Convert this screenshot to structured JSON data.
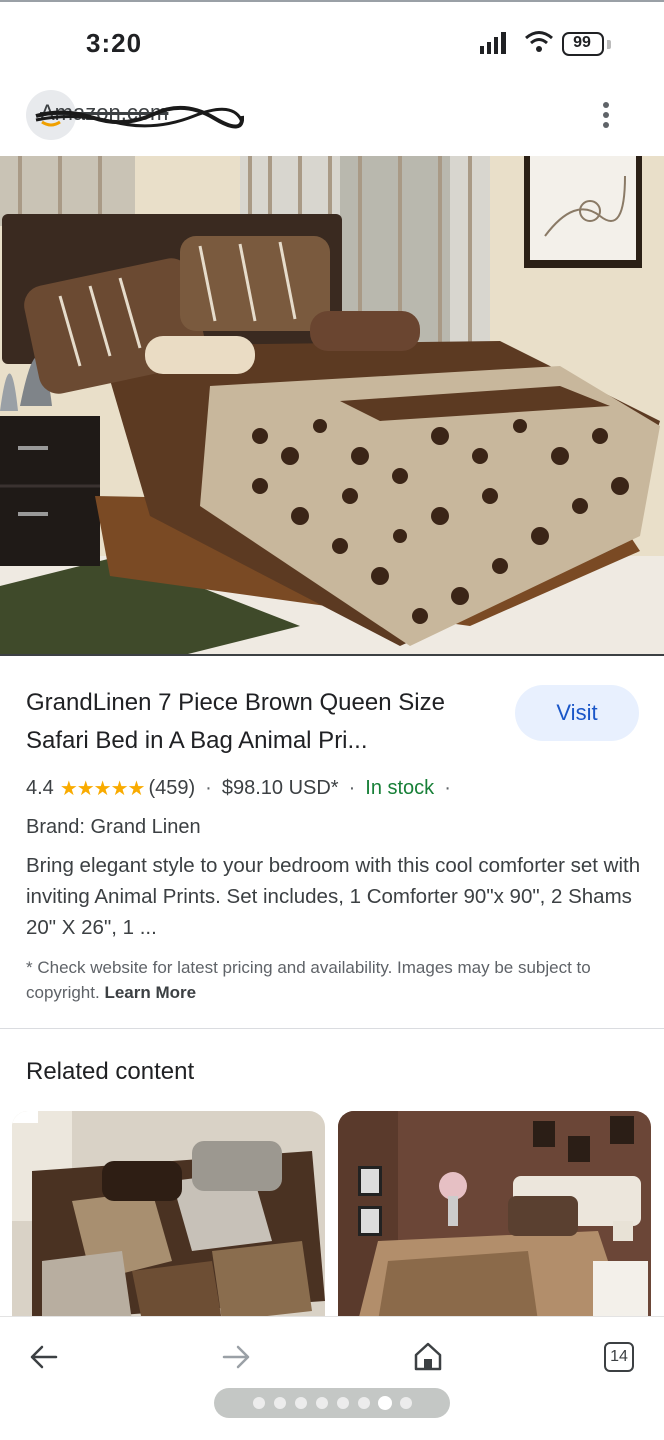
{
  "status_bar": {
    "time": "3:20",
    "battery": "99"
  },
  "site": {
    "name": "Amazon.com"
  },
  "product": {
    "title": "GrandLinen 7 Piece Brown Queen Size Safari Bed in A Bag Animal Pri...",
    "visit_label": "Visit",
    "rating": "4.4",
    "rating_value": 4.4,
    "stars": "★★★★★",
    "review_count": "(459)",
    "separator": "·",
    "price": "$98.10 USD*",
    "stock": "In stock",
    "brand": "Brand: Grand Linen",
    "description": "Bring elegant style to your bedroom with this cool comforter set with inviting Animal Prints. Set includes, 1 Comforter 90\"x 90\", 2 Shams 20\" X 26\", 1 ...",
    "disclaimer": "* Check website for latest pricing and availability. Images may be subject to copyright.",
    "learn_more": "Learn More"
  },
  "related": {
    "heading": "Related content"
  },
  "toolbar": {
    "tab_count": "14",
    "page_dots": 8,
    "active_dot": 6
  },
  "colors": {
    "accent": "#1a56c8",
    "visit_bg": "#e8f0fe",
    "stars": "#f9ab00",
    "in_stock": "#188038"
  },
  "icons": [
    "back-arrow-icon",
    "forward-arrow-icon",
    "home-icon",
    "tabs-icon",
    "more-vert-icon",
    "signal-icon",
    "wifi-icon",
    "battery-icon"
  ]
}
